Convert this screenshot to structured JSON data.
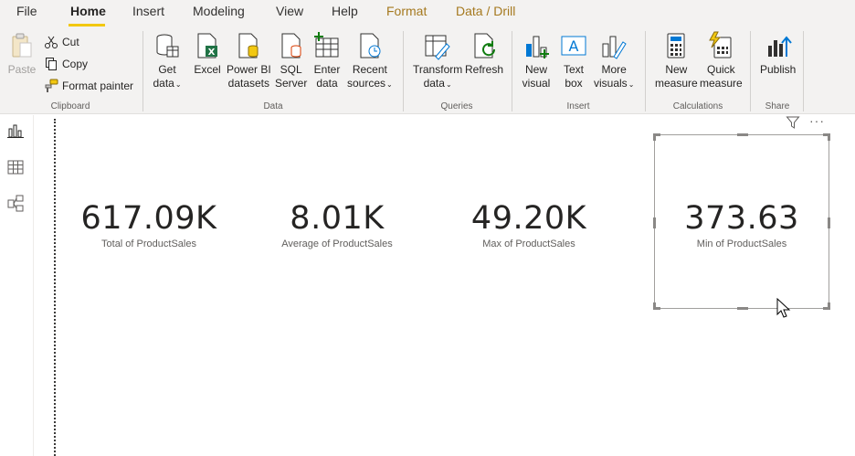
{
  "tabs": [
    {
      "label": "File"
    },
    {
      "label": "Home"
    },
    {
      "label": "Insert"
    },
    {
      "label": "Modeling"
    },
    {
      "label": "View"
    },
    {
      "label": "Help"
    },
    {
      "label": "Format"
    },
    {
      "label": "Data / Drill"
    }
  ],
  "ribbon": {
    "clipboard": {
      "label": "Clipboard",
      "paste": "Paste",
      "cut": "Cut",
      "copy": "Copy",
      "format_painter": "Format painter"
    },
    "data": {
      "label": "Data",
      "get_data": [
        "Get",
        "data"
      ],
      "excel": "Excel",
      "powerbi": [
        "Power BI",
        "datasets"
      ],
      "sql": [
        "SQL",
        "Server"
      ],
      "enter": [
        "Enter",
        "data"
      ],
      "recent": [
        "Recent",
        "sources"
      ]
    },
    "queries": {
      "label": "Queries",
      "transform": [
        "Transform",
        "data"
      ],
      "refresh": "Refresh"
    },
    "insert": {
      "label": "Insert",
      "new_visual": [
        "New",
        "visual"
      ],
      "text_box": [
        "Text",
        "box"
      ],
      "more_visuals": [
        "More",
        "visuals"
      ]
    },
    "calculations": {
      "label": "Calculations",
      "new_measure": [
        "New",
        "measure"
      ],
      "quick_measure": [
        "Quick",
        "measure"
      ]
    },
    "share": {
      "label": "Share",
      "publish": "Publish"
    }
  },
  "cards": [
    {
      "value": "617.09K",
      "label": "Total of ProductSales"
    },
    {
      "value": "8.01K",
      "label": "Average of ProductSales"
    },
    {
      "value": "49.20K",
      "label": "Max of ProductSales"
    },
    {
      "value": "373.63",
      "label": "Min of ProductSales"
    }
  ],
  "visual_tools": {
    "more": "···"
  },
  "colors": {
    "accent_yellow": "#f2c811",
    "context_tab": "#a5791f",
    "excel_green": "#217346",
    "blue_icon": "#0078d4"
  }
}
